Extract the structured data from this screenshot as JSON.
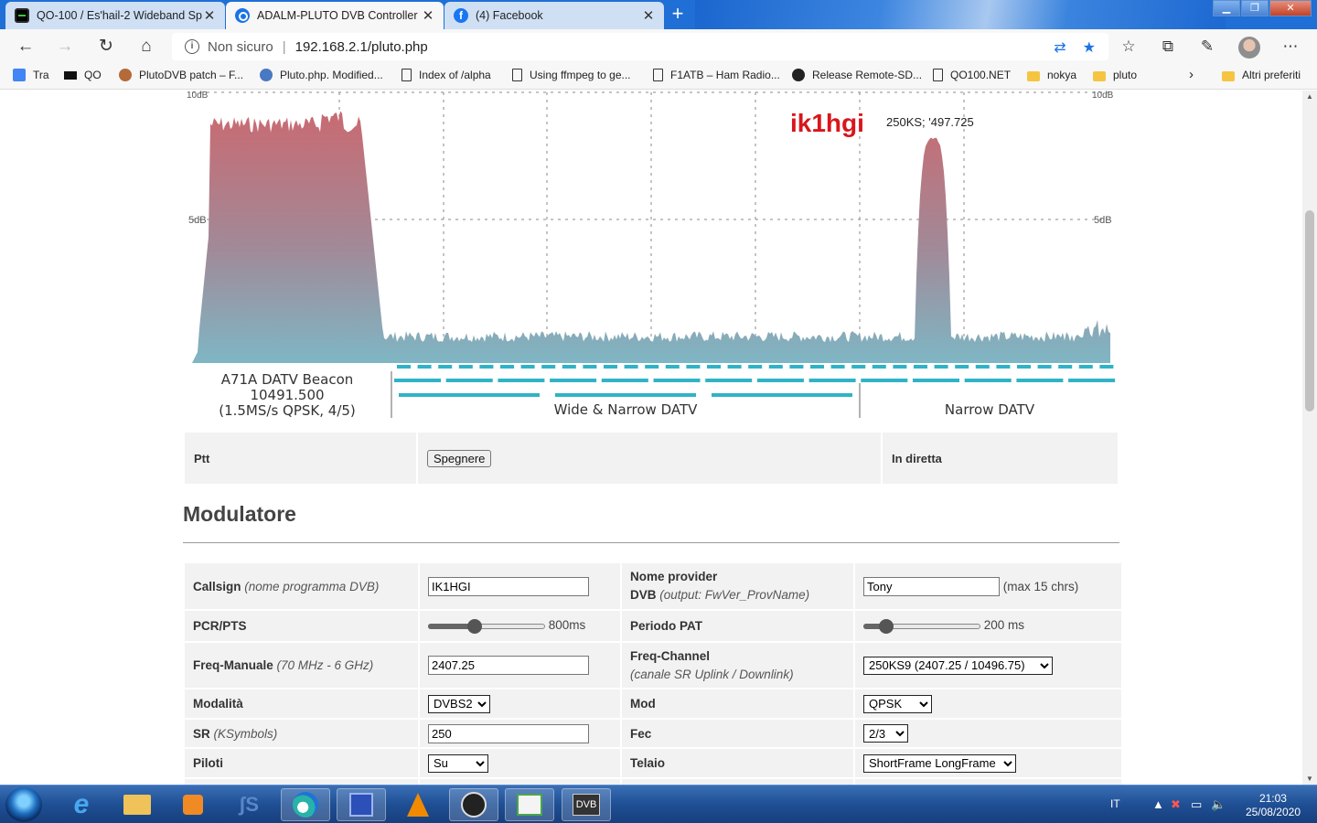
{
  "browser": {
    "tabs": [
      {
        "title": "QO-100 / Es'hail-2 Wideband Sp",
        "active": false,
        "icon": "qo-favicon-icon"
      },
      {
        "title": "ADALM-PLUTO DVB Controller",
        "active": true,
        "icon": "edge-favicon-icon"
      },
      {
        "title": "(4) Facebook",
        "active": false,
        "icon": "facebook-favicon-icon"
      }
    ],
    "new_tab": "+",
    "security_label": "Non sicuro",
    "url": "192.168.2.1/pluto.php",
    "bookmarks": [
      {
        "label": "Tra",
        "icon": "translate"
      },
      {
        "label": "QO",
        "icon": "qo"
      },
      {
        "label": "PlutoDVB patch – F...",
        "icon": "patch"
      },
      {
        "label": "Pluto.php. Modified...",
        "icon": "globe"
      },
      {
        "label": "Index of /alpha",
        "icon": "doc"
      },
      {
        "label": "Using ffmpeg to ge...",
        "icon": "doc"
      },
      {
        "label": "F1ATB – Ham Radio...",
        "icon": "doc"
      },
      {
        "label": "Release Remote-SD...",
        "icon": "github"
      },
      {
        "label": "QO100.NET",
        "icon": "doc"
      },
      {
        "label": "nokya",
        "icon": "folder"
      },
      {
        "label": "pluto",
        "icon": "folder"
      }
    ],
    "bookmarks_more": "›",
    "other_favorites": "Altri preferiti"
  },
  "spectrum": {
    "top_left_label": "10dB",
    "top_right_label": "10dB",
    "mid_left_label": "5dB",
    "mid_right_label": "5dB",
    "callsign_overlay": "ik1hgi",
    "marker_text": "250KS; '497.725",
    "beacon_line1": "A71A DATV Beacon",
    "beacon_line2": "10491.500",
    "beacon_line3": "(1.5MS/s QPSK, 4/5)",
    "band_wide": "Wide & Narrow DATV",
    "band_narrow": "Narrow DATV",
    "colors": {
      "signal_top": "#c96a72",
      "signal_bottom": "#7fb6c4",
      "channel_bars": "#2fb3c7"
    }
  },
  "ptt": {
    "label": "Ptt",
    "button": "Spegnere",
    "status": "In diretta"
  },
  "modulator": {
    "title": "Modulatore",
    "callsign_label": "Callsign",
    "callsign_hint": "(nome programma DVB)",
    "callsign_value": "IK1HGI",
    "provider_label1": "Nome provider",
    "provider_label2": "DVB",
    "provider_hint": "(output: FwVer_ProvName)",
    "provider_value": "Tony",
    "provider_note": "(max 15 chrs)",
    "pcr_label": "PCR/PTS",
    "pcr_value": "800ms",
    "pcr_level": 0.38,
    "pat_label": "Periodo PAT",
    "pat_value": "200 ms",
    "pat_level": 0.15,
    "freq_label": "Freq-Manuale",
    "freq_hint": "(70 MHz - 6 GHz)",
    "freq_value": "2407.25",
    "channel_label": "Freq-Channel",
    "channel_hint": "(canale SR Uplink / Downlink)",
    "channel_value": "250KS9 (2407.25 / 10496.75)",
    "mode_label": "Modalità",
    "mode_value": "DVBS2",
    "mod_label": "Mod",
    "mod_value": "QPSK",
    "sr_label": "SR",
    "sr_hint": "(KSymbols)",
    "sr_value": "250",
    "fec_label": "Fec",
    "fec_value": "2/3",
    "pilots_label": "Piloti",
    "pilots_value": "Su",
    "frame_label": "Telaio",
    "frame_value": "ShortFrame LongFrame"
  },
  "taskbar": {
    "language": "IT",
    "time": "21:03",
    "date": "25/08/2020"
  }
}
